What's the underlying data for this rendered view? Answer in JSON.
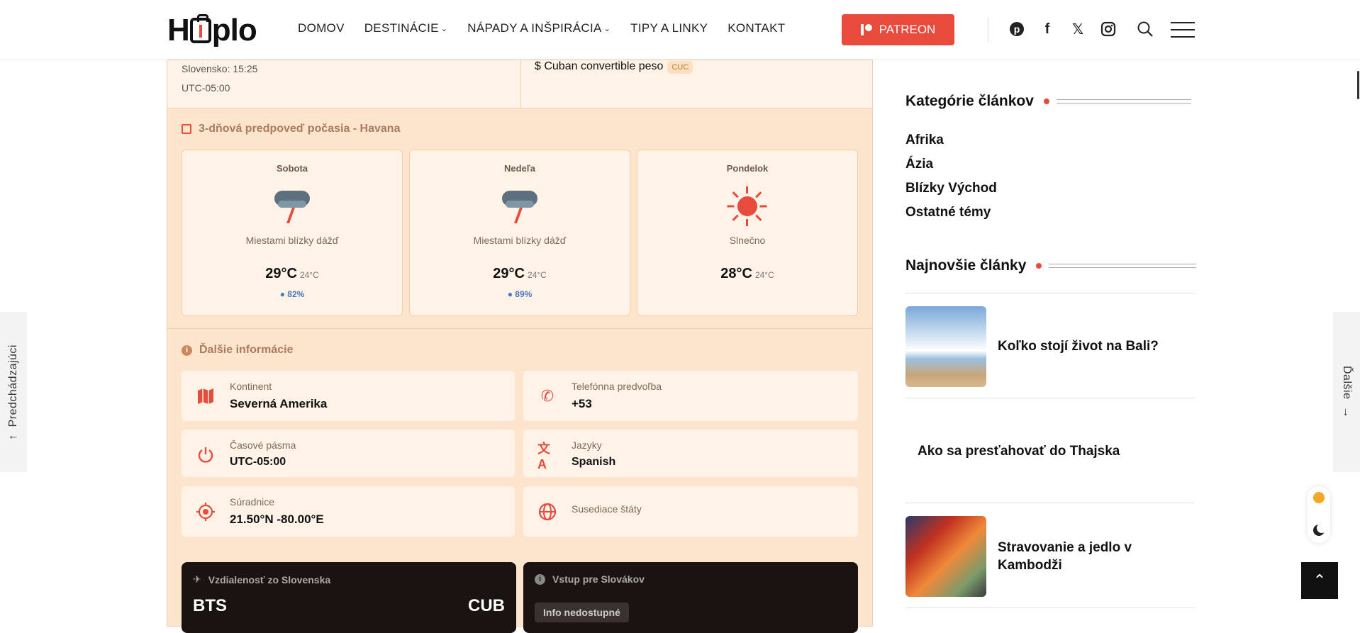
{
  "header": {
    "logo": "Hplo",
    "nav": [
      {
        "label": "DOMOV",
        "has_menu": false
      },
      {
        "label": "DESTINÁCIE",
        "has_menu": true
      },
      {
        "label": "NÁPADY A INŠPIRÁCIA",
        "has_menu": true
      },
      {
        "label": "TIPY A LINKY",
        "has_menu": false
      },
      {
        "label": "KONTAKT",
        "has_menu": false
      }
    ],
    "patreon_label": "PATREON",
    "accent": "#e84a3c"
  },
  "time": {
    "slovakia": "Slovensko: 15:25",
    "utc": "UTC-05:00"
  },
  "currency": {
    "label": "$ Cuban convertible peso",
    "code": "CUC"
  },
  "forecast": {
    "title": "3-dňová predpoveď počasia - Havana",
    "days": [
      {
        "day": "Sobota",
        "icon": "thunder-cloud-icon",
        "desc": "Miestami blízky dážď",
        "high": "29°C",
        "low": "24°C",
        "humidity": "82%"
      },
      {
        "day": "Nedeľa",
        "icon": "thunder-cloud-icon",
        "desc": "Miestami blízky dážď",
        "high": "29°C",
        "low": "24°C",
        "humidity": "89%"
      },
      {
        "day": "Pondelok",
        "icon": "sun-icon",
        "desc": "Slnečno",
        "high": "28°C",
        "low": "24°C",
        "humidity": ""
      }
    ]
  },
  "info": {
    "title": "Ďalšie informácie",
    "items": [
      {
        "icon": "map-icon",
        "label": "Kontinent",
        "value": "Severná Amerika"
      },
      {
        "icon": "phone-icon",
        "label": "Telefónna predvoľba",
        "value": "+53"
      },
      {
        "icon": "power-icon",
        "label": "Časové pásma",
        "value": "UTC-05:00"
      },
      {
        "icon": "translate-icon",
        "label": "Jazyky",
        "value": "Spanish"
      },
      {
        "icon": "target-icon",
        "label": "Súradnice",
        "value": "21.50°N -80.00°E"
      },
      {
        "icon": "globe-icon",
        "label": "Susediace štáty",
        "value": ""
      }
    ]
  },
  "distance": {
    "title": "Vzdialenosť zo Slovenska",
    "from": "BTS",
    "to": "CUB"
  },
  "entry": {
    "title": "Vstup pre Slovákov",
    "badge": "Info nedostupné"
  },
  "sidebar": {
    "categories_title": "Kategórie článkov",
    "categories": [
      "Afrika",
      "Ázia",
      "Blízky Východ",
      "Ostatné témy"
    ],
    "latest_title": "Najnovšie články",
    "posts": [
      {
        "title": "Koľko stojí život na Bali?",
        "thumb": "beach"
      },
      {
        "title": "Ako sa presťahovať do Thajska",
        "thumb": ""
      },
      {
        "title": "Stravovanie a jedlo v Kambodži",
        "thumb": "food"
      }
    ]
  },
  "side_nav": {
    "prev": "Predchádzajúci",
    "next": "Ďalšie"
  }
}
